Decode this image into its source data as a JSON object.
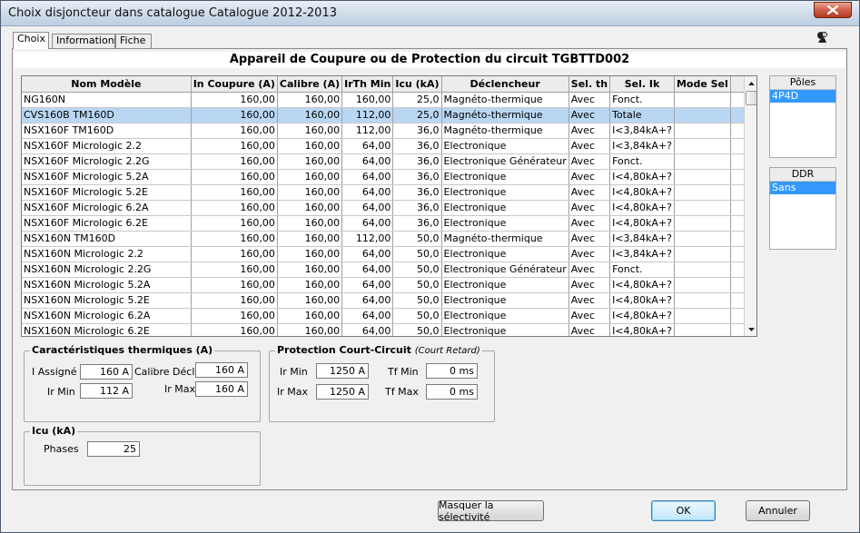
{
  "window": {
    "title": "Choix disjoncteur dans catalogue Catalogue 2012-2013"
  },
  "tabs": [
    {
      "label": "Choix",
      "active": true
    },
    {
      "label": "Informations",
      "active": false
    },
    {
      "label": "Fiche",
      "active": false
    }
  ],
  "heading": "Appareil de Coupure ou de Protection du circuit TGBTTD002",
  "table": {
    "columns": [
      "Nom Modèle",
      "In Coupure (A)",
      "Calibre (A)",
      "IrTh Min",
      "Icu (kA)",
      "Déclencheur",
      "Sel. th",
      "Sel. Ik",
      "Mode Sel"
    ],
    "selected_index": 1,
    "rows": [
      [
        "NG160N",
        "160,00",
        "160,00",
        "160,00",
        "25,0",
        "Magnéto-thermique",
        "Avec",
        "Fonct.",
        ""
      ],
      [
        "CVS160B TM160D",
        "160,00",
        "160,00",
        "112,00",
        "25,0",
        "Magnéto-thermique",
        "Avec",
        "Totale",
        ""
      ],
      [
        "NSX160F TM160D",
        "160,00",
        "160,00",
        "112,00",
        "36,0",
        "Magnéto-thermique",
        "Avec",
        "I<3,84kA+?",
        ""
      ],
      [
        "NSX160F Micrologic 2.2",
        "160,00",
        "160,00",
        "64,00",
        "36,0",
        "Electronique",
        "Avec",
        "I<3,84kA+?",
        ""
      ],
      [
        "NSX160F Micrologic 2.2G",
        "160,00",
        "160,00",
        "64,00",
        "36,0",
        "Electronique Générateur",
        "Avec",
        "Fonct.",
        ""
      ],
      [
        "NSX160F Micrologic 5.2A",
        "160,00",
        "160,00",
        "64,00",
        "36,0",
        "Electronique",
        "Avec",
        "I<4,80kA+?",
        ""
      ],
      [
        "NSX160F Micrologic 5.2E",
        "160,00",
        "160,00",
        "64,00",
        "36,0",
        "Electronique",
        "Avec",
        "I<4,80kA+?",
        ""
      ],
      [
        "NSX160F Micrologic 6.2A",
        "160,00",
        "160,00",
        "64,00",
        "36,0",
        "Electronique",
        "Avec",
        "I<4,80kA+?",
        ""
      ],
      [
        "NSX160F Micrologic 6.2E",
        "160,00",
        "160,00",
        "64,00",
        "36,0",
        "Electronique",
        "Avec",
        "I<4,80kA+?",
        ""
      ],
      [
        "NSX160N TM160D",
        "160,00",
        "160,00",
        "112,00",
        "50,0",
        "Magnéto-thermique",
        "Avec",
        "I<3,84kA+?",
        ""
      ],
      [
        "NSX160N Micrologic 2.2",
        "160,00",
        "160,00",
        "64,00",
        "50,0",
        "Electronique",
        "Avec",
        "I<3,84kA+?",
        ""
      ],
      [
        "NSX160N Micrologic 2.2G",
        "160,00",
        "160,00",
        "64,00",
        "50,0",
        "Electronique Générateur",
        "Avec",
        "Fonct.",
        ""
      ],
      [
        "NSX160N Micrologic 5.2A",
        "160,00",
        "160,00",
        "64,00",
        "50,0",
        "Electronique",
        "Avec",
        "I<4,80kA+?",
        ""
      ],
      [
        "NSX160N Micrologic 5.2E",
        "160,00",
        "160,00",
        "64,00",
        "50,0",
        "Electronique",
        "Avec",
        "I<4,80kA+?",
        ""
      ],
      [
        "NSX160N Micrologic 6.2A",
        "160,00",
        "160,00",
        "64,00",
        "50,0",
        "Electronique",
        "Avec",
        "I<4,80kA+?",
        ""
      ],
      [
        "NSX160N Micrologic 6.2E",
        "160,00",
        "160,00",
        "64,00",
        "50,0",
        "Electronique",
        "Avec",
        "I<4,80kA+?",
        ""
      ]
    ]
  },
  "poles": {
    "header": "Pôles",
    "selected": "4P4D"
  },
  "ddr": {
    "header": "DDR",
    "selected": "Sans"
  },
  "thermal": {
    "title": "Caractéristiques thermiques (A)",
    "i_assigne_label": "I Assigné",
    "i_assigne_value": "160 A",
    "calibre_decl_label": "Calibre Décl.",
    "calibre_decl_value": "160 A",
    "ir_min_label": "Ir Min",
    "ir_min_value": "112 A",
    "ir_max_label": "Ir Max",
    "ir_max_value": "160 A"
  },
  "short_circuit": {
    "title": "Protection Court-Circuit",
    "subtitle": "(Court Retard)",
    "ir_min_label": "Ir Min",
    "ir_min_value": "1250 A",
    "ir_max_label": "Ir Max",
    "ir_max_value": "1250 A",
    "tf_min_label": "Tf Min",
    "tf_min_value": "0 ms",
    "tf_max_label": "Tf Max",
    "tf_max_value": "0 ms"
  },
  "icu": {
    "title": "Icu (kA)",
    "phases_label": "Phases",
    "phases_value": "25"
  },
  "buttons": {
    "masquer": "Masquer la sélectivité",
    "ok": "OK",
    "annuler": "Annuler"
  }
}
